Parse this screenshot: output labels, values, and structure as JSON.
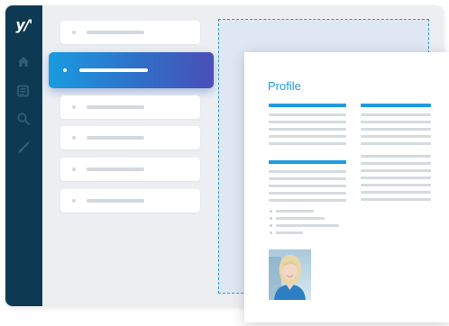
{
  "window": {
    "logo_text": "y/'",
    "sidebar": {
      "icons": [
        "home-icon",
        "news-icon",
        "search-icon",
        "brush-icon"
      ],
      "background": "#0d3a52"
    },
    "list": {
      "items": [
        {
          "state": "default"
        },
        {
          "state": "selected"
        },
        {
          "state": "default"
        },
        {
          "state": "default"
        },
        {
          "state": "default"
        },
        {
          "state": "default"
        }
      ],
      "accent_gradient": [
        "#1a9be0",
        "#4a4fb8"
      ]
    }
  },
  "document": {
    "title": "Profile",
    "accent": "#1f9be0"
  }
}
